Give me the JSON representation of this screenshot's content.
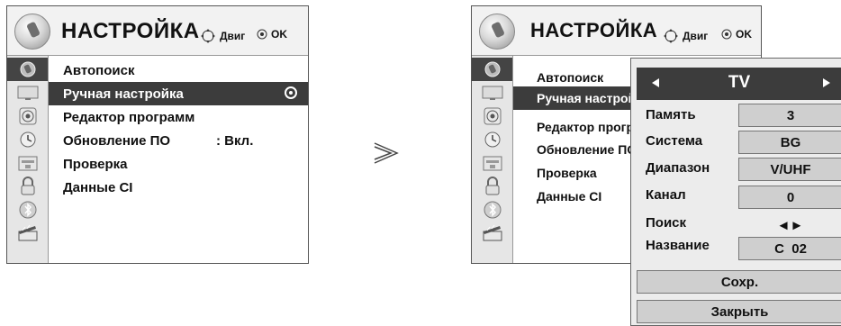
{
  "left_menu": {
    "title": "НАСТРОЙКА",
    "hint_move": "Двиг",
    "hint_ok": "OK",
    "items": [
      {
        "label": "Автопоиск",
        "value": ""
      },
      {
        "label": "Ручная настройка",
        "value": ""
      },
      {
        "label": "Редактор программ",
        "value": ""
      },
      {
        "label": "Обновление ПО",
        "value": ": Вкл."
      },
      {
        "label": "Проверка",
        "value": ""
      },
      {
        "label": "Данные CI",
        "value": ""
      }
    ],
    "selected_index": 1,
    "icons": [
      "satellite-icon",
      "tv-screen-icon",
      "speaker-icon",
      "clock-icon",
      "lock-panel-icon",
      "padlock-icon",
      "bluetooth-icon",
      "clapperboard-icon"
    ]
  },
  "transition_symbol": "arrow-right-icon",
  "right_menu": {
    "title": "НАСТРОЙКА",
    "hint_move": "Двиг",
    "hint_ok": "OK",
    "items": [
      {
        "label": "Автопоиск"
      },
      {
        "label": "Ручная настрой"
      },
      {
        "label": "Редактор прогр"
      },
      {
        "label": "Обновление ПО"
      },
      {
        "label": "Проверка"
      },
      {
        "label": "Данные CI"
      }
    ],
    "selected_index": 1
  },
  "popup": {
    "source": "TV",
    "fields": [
      {
        "label": "Память",
        "value": "3"
      },
      {
        "label": "Система",
        "value": "BG"
      },
      {
        "label": "Диапазон",
        "value": "V/UHF"
      },
      {
        "label": "Канал",
        "value": "0"
      },
      {
        "label": "Поиск",
        "value": "◄►"
      },
      {
        "label": "Название",
        "value": "C  02"
      }
    ],
    "save_label": "Сохр.",
    "close_label": "Закрыть"
  },
  "colors": {
    "selected_bg": "#3c3c3c",
    "field_bg": "#cfcfcf",
    "panel_bg": "#ececec"
  }
}
